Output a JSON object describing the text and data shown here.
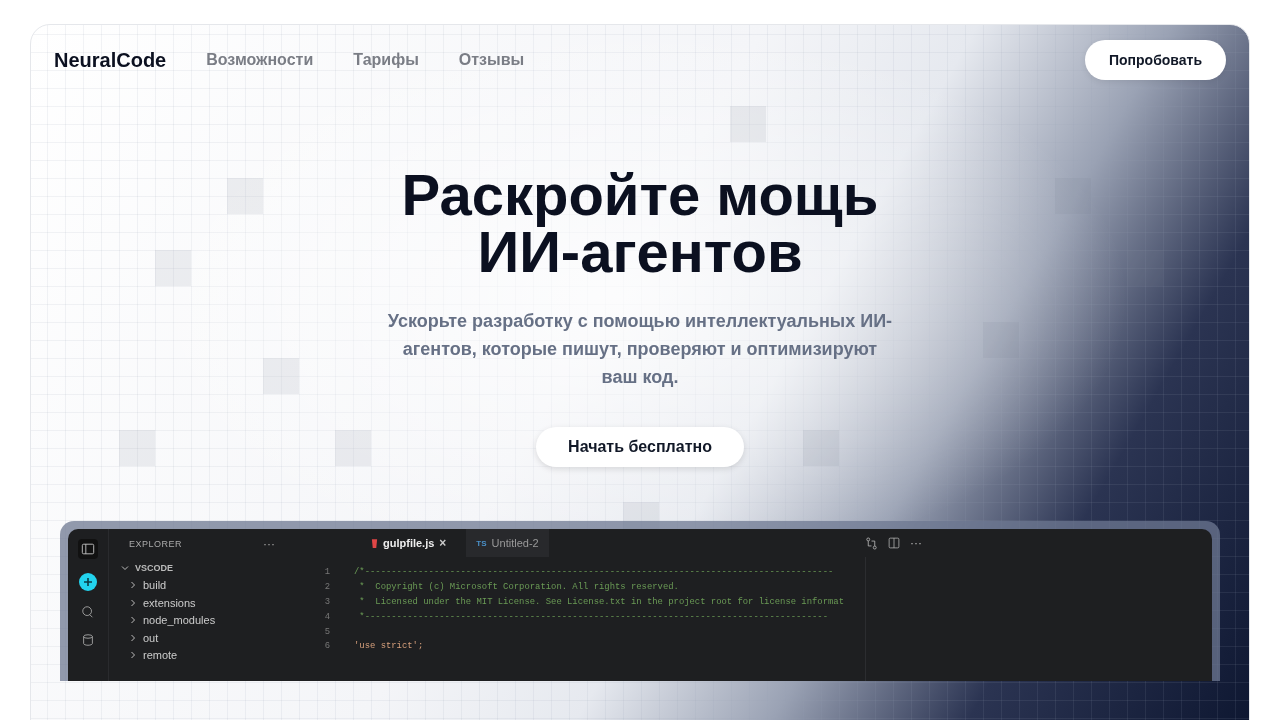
{
  "nav": {
    "brand": "NeuralCode",
    "links": [
      "Возможности",
      "Тарифы",
      "Отзывы"
    ],
    "cta": "Попробовать"
  },
  "hero": {
    "title": "Раскройте мощь ИИ-агентов",
    "subtitle": "Ускорьте разработку с помощью интеллектуальных ИИ-агентов, которые пишут, проверяют и оптимизируют ваш код.",
    "button": "Начать бесплатно"
  },
  "editor": {
    "explorer_title": "EXPLORER",
    "more": "···",
    "tree": [
      {
        "label": "VSCODE",
        "expanded": true,
        "children": [
          {
            "label": "build",
            "expanded": false
          },
          {
            "label": "extensions",
            "expanded": false
          },
          {
            "label": "node_modules",
            "expanded": false
          },
          {
            "label": "out",
            "expanded": false
          },
          {
            "label": "remote",
            "expanded": false
          }
        ]
      }
    ],
    "tabs": [
      {
        "label": "gulpfile.js",
        "kind": "js",
        "selected": true,
        "close": "×"
      },
      {
        "label": "Untitled-2",
        "kind": "ts",
        "badge": "TS",
        "selected": false
      }
    ],
    "toolbar_more": "···",
    "lines": [
      {
        "number": "1",
        "kind": "comment",
        "text": "/*----------------------------------------------------------------------------------------"
      },
      {
        "number": "2",
        "kind": "comment",
        "text": " *  Copyright (c) Microsoft Corporation. All rights reserved."
      },
      {
        "number": "3",
        "kind": "comment",
        "text": " *  Licensed under the MIT License. See License.txt in the project root for license informat"
      },
      {
        "number": "4",
        "kind": "comment",
        "text": " *---------------------------------------------------------------------------------------"
      },
      {
        "number": "5",
        "kind": "blank"
      },
      {
        "number": "6",
        "kind": "statement",
        "text": "'use strict';"
      }
    ]
  }
}
